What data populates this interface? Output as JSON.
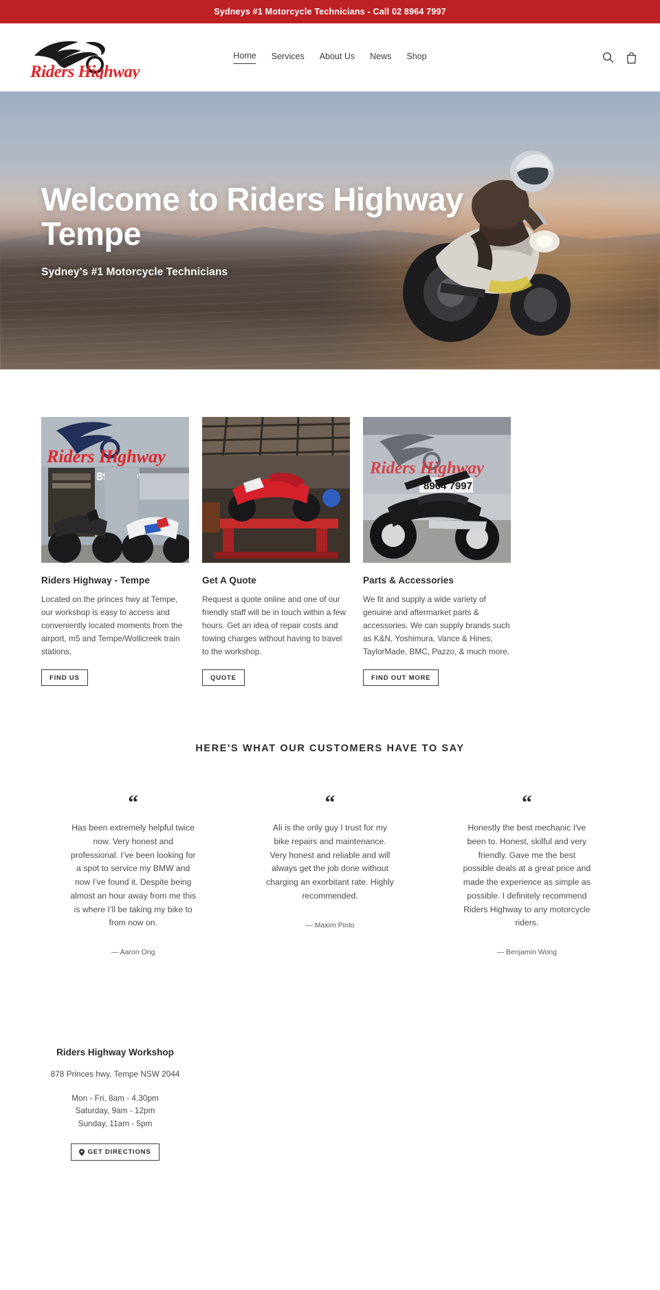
{
  "announcement": {
    "text": "Sydneys #1 Motorcycle Technicians - Call 02 8964 7997"
  },
  "header": {
    "logo_text": "Riders Highway",
    "nav": [
      {
        "label": "Home",
        "active": true
      },
      {
        "label": "Services",
        "active": false
      },
      {
        "label": "About Us",
        "active": false
      },
      {
        "label": "News",
        "active": false
      },
      {
        "label": "Shop",
        "active": false
      }
    ],
    "search_icon": "search-icon",
    "cart_icon": "shopping-bag-icon"
  },
  "hero": {
    "title": "Welcome to Riders Highway Tempe",
    "subtitle": "Sydney's #1 Motorcycle Technicians"
  },
  "cards": [
    {
      "title": "Riders Highway - Tempe",
      "text": "Located on the princes hwy at Tempe,  our workshop is easy to access and conveniently located moments from the airport, m5 and Tempe/Wollicreek train stations,",
      "button": "FIND US",
      "image_alt": "riders-highway-shopfront-with-motorcycles"
    },
    {
      "title": "Get A Quote",
      "text": "Request a quote online and one of our friendly staff will be in touch within a few hours. Get an idea of repair costs and towing charges without having to travel to the workshop.",
      "button": "QUOTE",
      "image_alt": "red-motorcycle-on-workshop-lift"
    },
    {
      "title": "Parts & Accessories",
      "text": "We fit and supply a wide variety of genuine and aftermarket parts & accessories. We can supply brands such as K&N, Yoshimura, Vance & Hines, TaylorMade, BMC, Pazzo, & much more.",
      "button": "FIND OUT MORE",
      "image_alt": "black-cruiser-motorcycle-outside-workshop"
    }
  ],
  "testimonials": {
    "heading": "HERE'S WHAT OUR CUSTOMERS HAVE TO SAY",
    "quote_mark": "“",
    "items": [
      {
        "text": "Has been extremely helpful twice now. Very honest and professional. I’ve been looking for a spot to service my BMW and now I’ve found it. Despite being almost an hour away from me this is where I’ll be taking my bike to from now on.",
        "author": "— Aaron Ong"
      },
      {
        "text": "Ali is the only guy I trust for my bike repairs and maintenance. Very honest and reliable and will always get the job done without charging an exorbitant rate. Highly recommended.",
        "author": "— Maxim Pinto"
      },
      {
        "text": "Honestly the best mechanic I've been to. Honest, skilful and very friendly. Gave me the best possible deals at a great price and made the experience as simple as possible. I definitely recommend Riders Highway to any motorcycle riders.",
        "author": "— Benjamin Wong"
      }
    ]
  },
  "workshop": {
    "name": "Riders Highway Workshop",
    "address": "878 Princes hwy, Tempe NSW 2044",
    "hours_line1": "Mon - Fri, 8am - 4.30pm",
    "hours_line2": "Saturday, 9am - 12pm",
    "hours_line3": "Sunday, 11am - 5pm",
    "directions_button": "GET DIRECTIONS",
    "directions_icon": "map-pin-icon"
  },
  "colors": {
    "announce_bg": "#bf2026",
    "logo_red": "#e0262b",
    "text": "#3c3c3c"
  }
}
